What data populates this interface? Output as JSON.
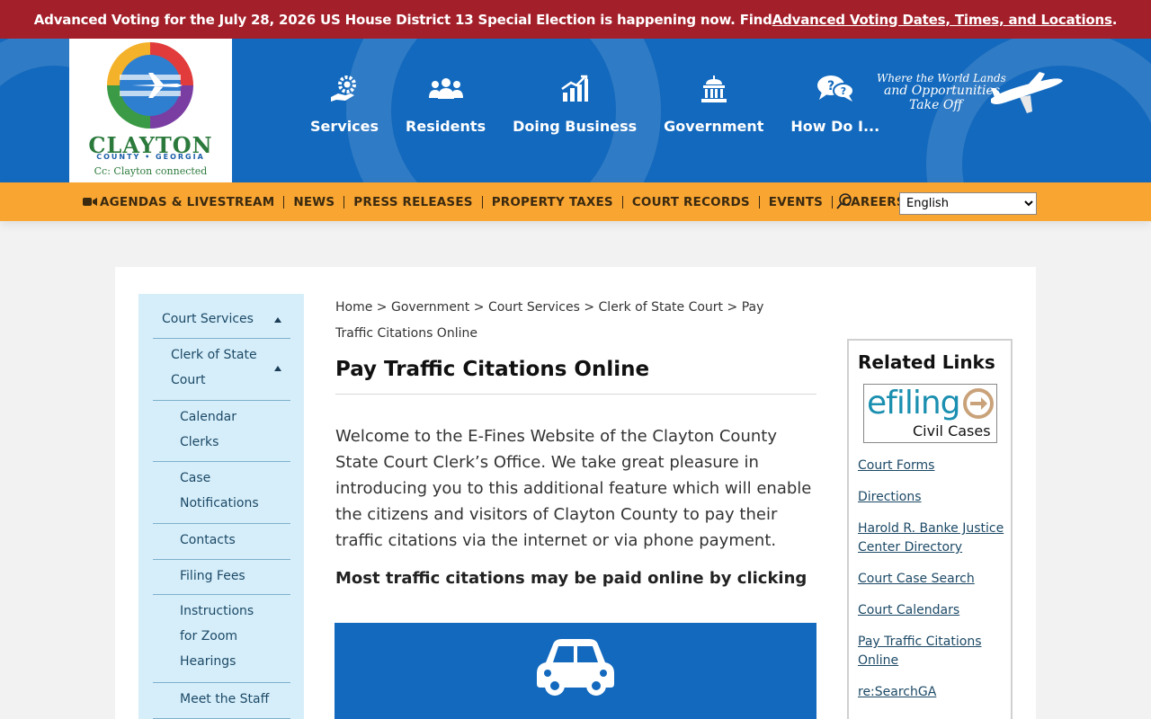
{
  "alert": {
    "text": "Advanced Voting for the July 28, 2026 US House District 13 Special Election is happening now. Find ",
    "link": "Advanced Voting Dates, Times, and Locations",
    "suffix": "."
  },
  "logo": {
    "brand": "CLAYTON",
    "sub": "COUNTY • GEORGIA",
    "tagline": "Cc: Clayton connected"
  },
  "main_nav": [
    {
      "label": "Services",
      "icon": "gear-hand-icon"
    },
    {
      "label": "Residents",
      "icon": "people-icon"
    },
    {
      "label": "Doing Business",
      "icon": "growth-chart-icon"
    },
    {
      "label": "Government",
      "icon": "capitol-building-icon"
    },
    {
      "label": "How Do I...",
      "icon": "question-chat-icon"
    }
  ],
  "slogan": {
    "line1": "Where the World Lands",
    "line2": "and Opportunities",
    "line3": "Take Off"
  },
  "sub_nav": [
    "AGENDAS & LIVESTREAM",
    "NEWS",
    "PRESS RELEASES",
    "PROPERTY TAXES",
    "COURT RECORDS",
    "EVENTS",
    "CAREERS"
  ],
  "language": {
    "selected": "English"
  },
  "sidebar": {
    "items": [
      "Court Services",
      "Clerk of State Court",
      "Calendar Clerks",
      "Case Notifications",
      "Contacts",
      "Filing Fees",
      "Instructions for Zoom Hearings",
      "Meet the Staff"
    ]
  },
  "breadcrumb": [
    "Home",
    "Government",
    "Court Services",
    "Clerk of State Court",
    "Pay Traffic Citations Online"
  ],
  "page": {
    "title": "Pay Traffic Citations Online",
    "intro": "Welcome to the E-Fines Website of the Clayton County State Court Clerk’s Office. We take great pleasure in introducing you to this additional feature which will enable the citizens and visitors of Clayton County to pay their traffic citations via the internet or via phone payment.",
    "emphasis": "Most traffic citations may be paid online by clicking"
  },
  "related": {
    "title": "Related Links",
    "efiling_word": "efiling",
    "efiling_sub": "Civil Cases",
    "links": [
      "Court Forms",
      "Directions",
      "Harold R. Banke Justice Center Directory",
      "Court Case Search",
      "Court Calendars",
      "Pay Traffic Citations Online",
      "re:SearchGA"
    ]
  },
  "colors": {
    "alert_bg": "#a31f2a",
    "header_bg": "#1369bd",
    "subnav_bg": "#f9a532",
    "sidebar_bg": "#d6eefa"
  }
}
